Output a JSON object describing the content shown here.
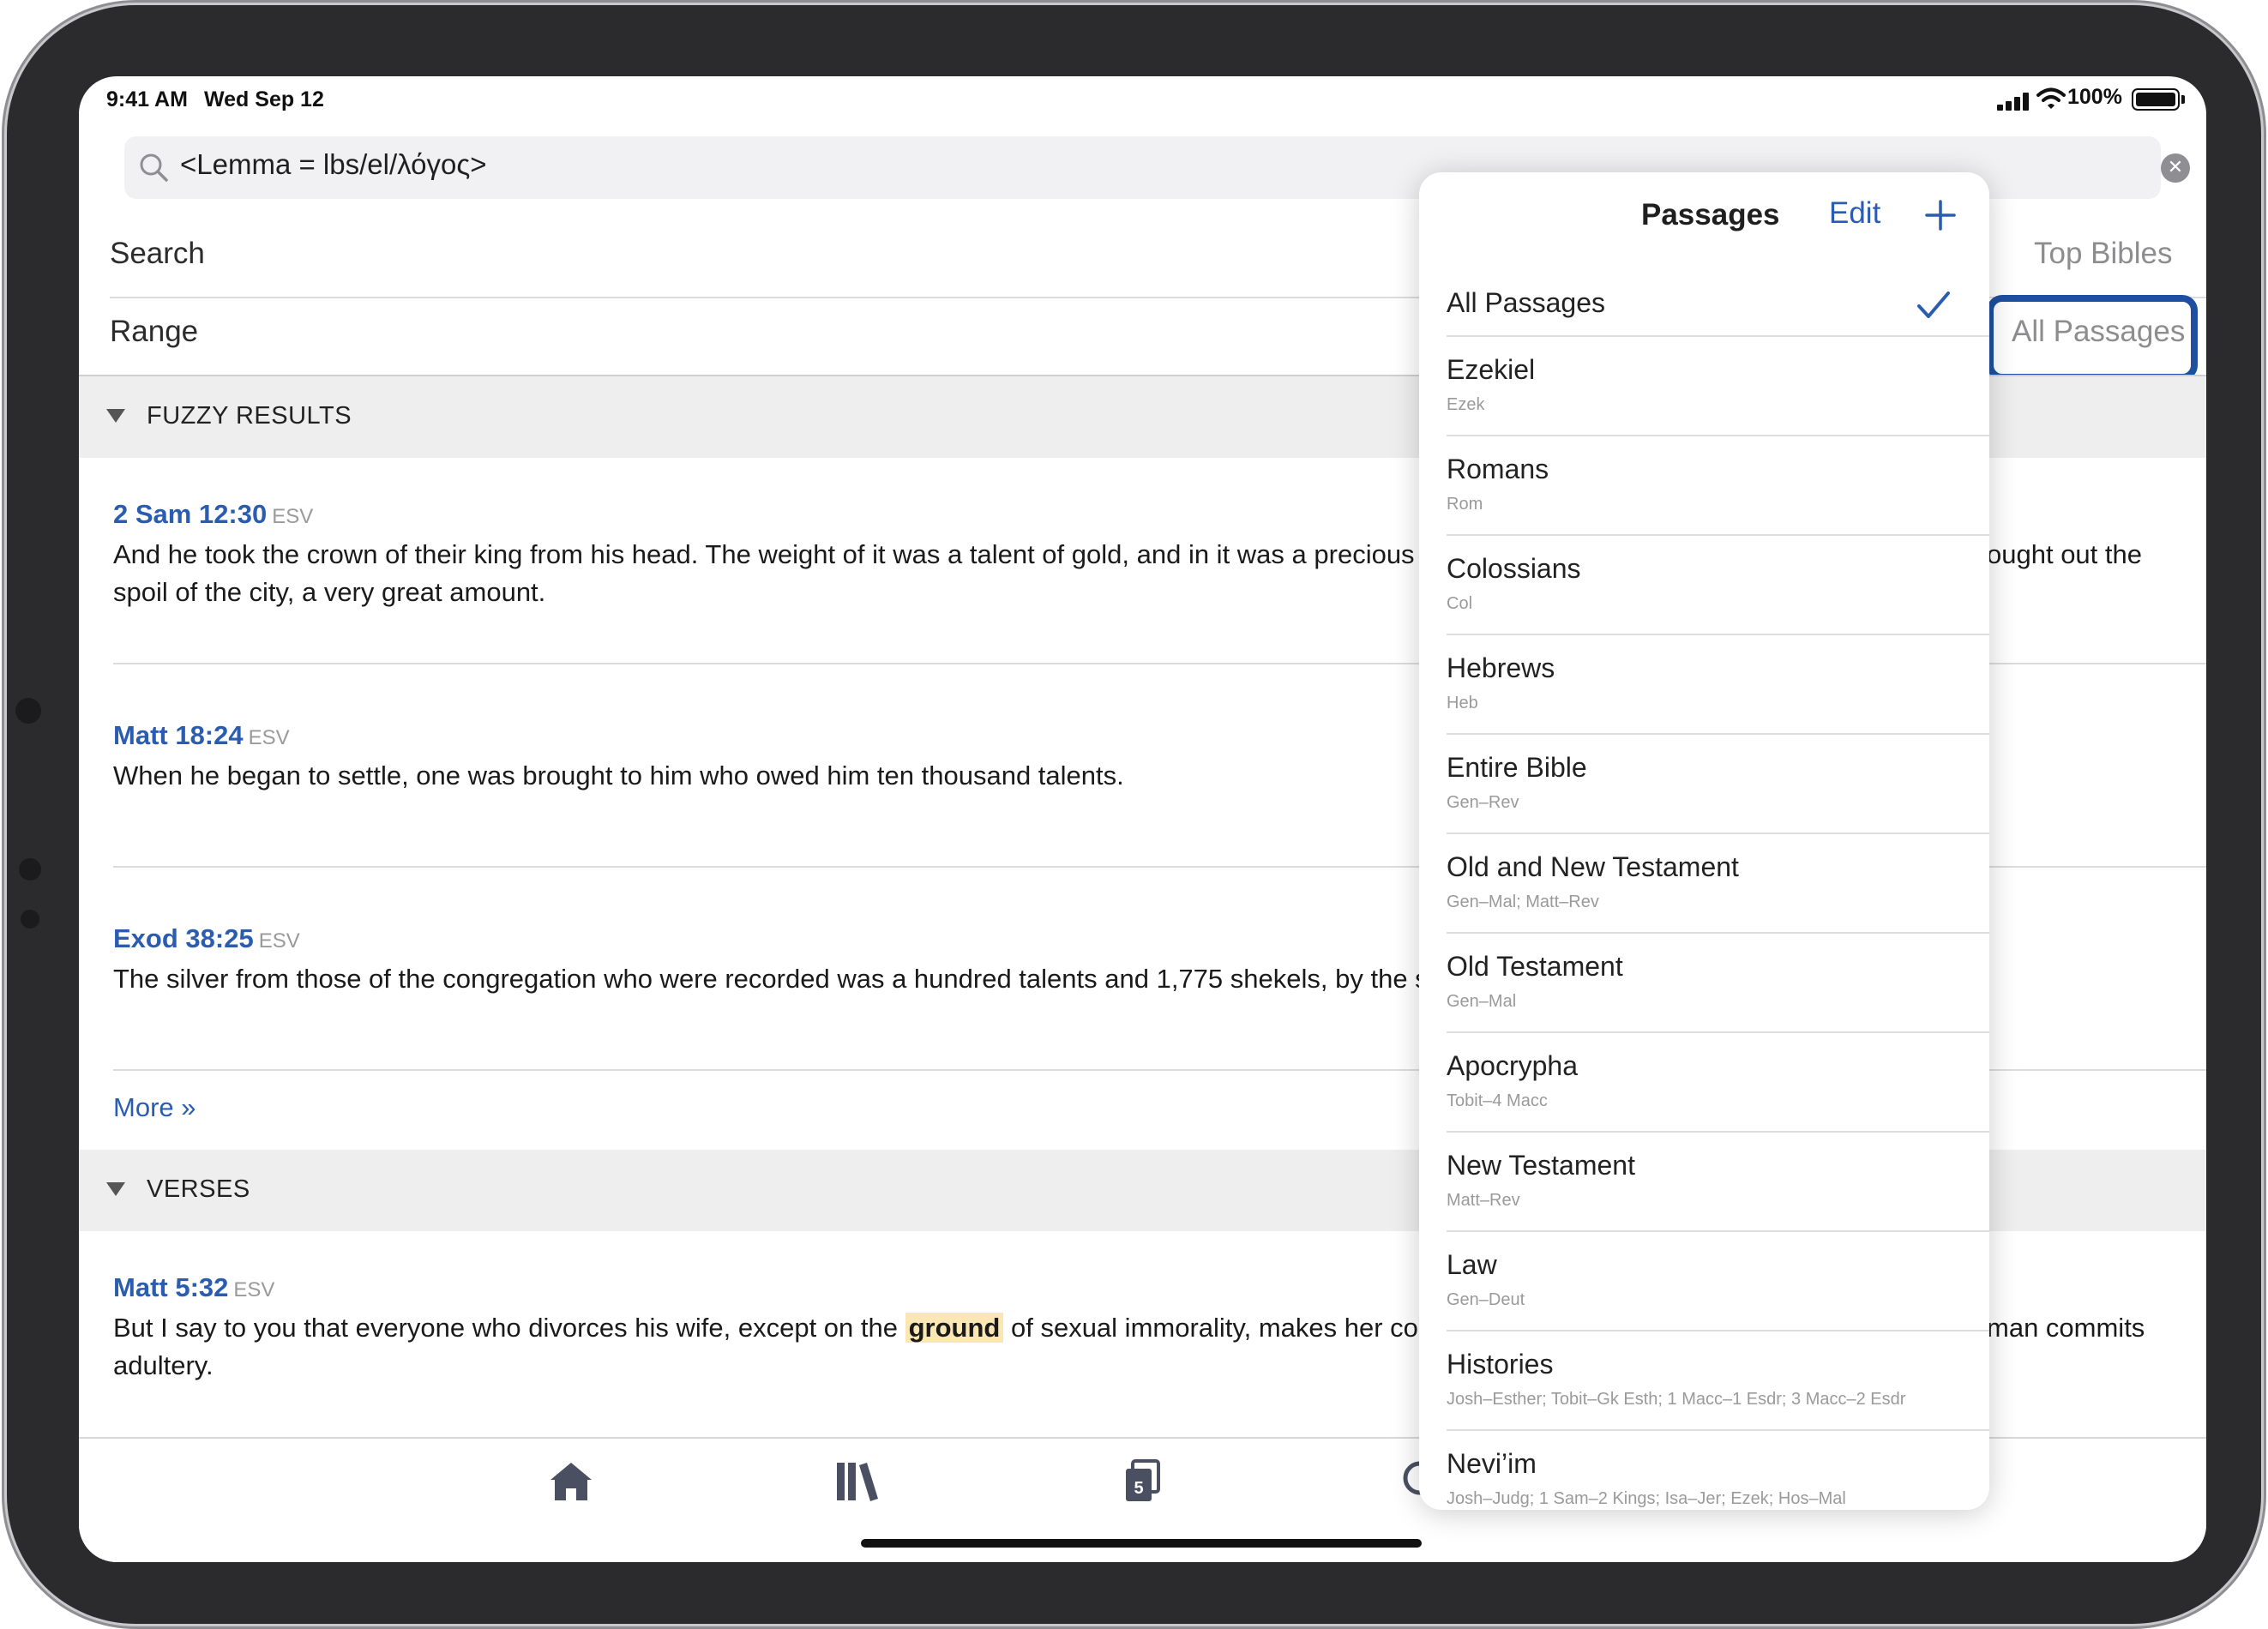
{
  "status": {
    "time": "9:41 AM",
    "date": "Wed Sep 12",
    "battery": "100%"
  },
  "search": {
    "query": "<Lemma = lbs/el/λόγος>"
  },
  "settings": {
    "search_label": "Search",
    "search_value": "Top Bibles",
    "range_label": "Range",
    "range_value": "All Passages"
  },
  "fuzzy": {
    "title": "FUZZY RESULTS",
    "results": [
      {
        "ref": "2 Sam 12:30",
        "version": "ESV",
        "line1": "And he took the crown of their king from his head. The weight of it was a talent of gold, and in it was a precious st",
        "line1_tail": "ought out the",
        "line2": "spoil of the city, a very great amount."
      },
      {
        "ref": "Matt 18:24",
        "version": "ESV",
        "line1": "When he began to settle, one was brought to him who owed him ten thousand talents."
      },
      {
        "ref": "Exod 38:25",
        "version": "ESV",
        "line1": "The silver from those of the congregation who were recorded was a hundred talents and 1,775 shekels, by the sh"
      }
    ],
    "more": "More »"
  },
  "verses": {
    "title": "VERSES",
    "results": [
      {
        "ref": "Matt 5:32",
        "version": "ESV",
        "before": "But I say to you that everyone who divorces his wife, except on the ",
        "highlight": "ground",
        "after": " of sexual immorality, makes her com",
        "tail": "man commits",
        "line2": "adultery."
      }
    ]
  },
  "tabbar": {
    "badge": "5"
  },
  "popover": {
    "title": "Passages",
    "edit": "Edit",
    "items": [
      {
        "name": "All Passages",
        "sub": "",
        "selected": true
      },
      {
        "name": "Ezekiel",
        "sub": "Ezek"
      },
      {
        "name": "Romans",
        "sub": "Rom"
      },
      {
        "name": "Colossians",
        "sub": "Col"
      },
      {
        "name": "Hebrews",
        "sub": "Heb"
      },
      {
        "name": "Entire Bible",
        "sub": "Gen–Rev"
      },
      {
        "name": "Old and New Testament",
        "sub": "Gen–Mal; Matt–Rev"
      },
      {
        "name": "Old Testament",
        "sub": "Gen–Mal"
      },
      {
        "name": "Apocrypha",
        "sub": "Tobit–4 Macc"
      },
      {
        "name": "New Testament",
        "sub": "Matt–Rev"
      },
      {
        "name": "Law",
        "sub": "Gen–Deut"
      },
      {
        "name": "Histories",
        "sub": "Josh–Esther; Tobit–Gk Esth; 1 Macc–1 Esdr; 3 Macc–2 Esdr"
      },
      {
        "name": "Nevi’im",
        "sub": "Josh–Judg; 1 Sam–2 Kings; Isa–Jer; Ezek; Hos–Mal"
      }
    ]
  },
  "colors": {
    "accent": "#2a5cb0",
    "highlight_border": "#1f4fa0",
    "highlight_word": "#fbe7b4"
  }
}
